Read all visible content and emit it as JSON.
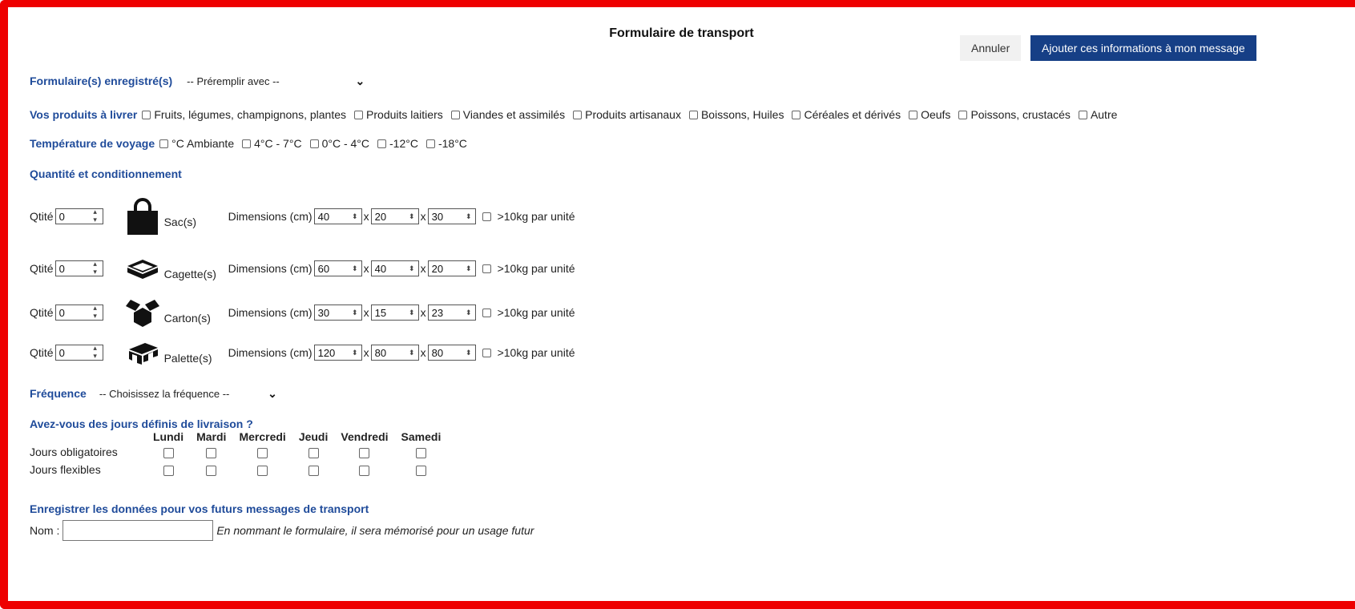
{
  "dialog": {
    "title": "Formulaire de transport",
    "cancel_label": "Annuler",
    "add_label": "Ajouter ces informations à mon message"
  },
  "saved_forms": {
    "label": "Formulaire(s) enregistré(s)",
    "select_value": "-- Préremplir avec --"
  },
  "products": {
    "label": "Vos produits à livrer",
    "options": [
      "Fruits, légumes, champignons, plantes",
      "Produits laitiers",
      "Viandes et assimilés",
      "Produits artisanaux",
      "Boissons, Huiles",
      "Céréales et dérivés",
      "Oeufs",
      "Poissons, crustacés",
      "Autre"
    ]
  },
  "temperature": {
    "label": "Température de voyage",
    "options": [
      "°C Ambiante",
      "4°C - 7°C",
      "0°C - 4°C",
      "-12°C",
      "-18°C"
    ]
  },
  "quantity": {
    "section_label": "Quantité et conditionnement",
    "qty_label": "Qtité",
    "dims_label": "Dimensions (cm)",
    "times": "x",
    "heavy_label": ">10kg par unité",
    "rows": [
      {
        "icon": "bag-icon",
        "type": "Sac(s)",
        "qty": "0",
        "d1": "40",
        "d2": "20",
        "d3": "30"
      },
      {
        "icon": "crate-icon",
        "type": "Cagette(s)",
        "qty": "0",
        "d1": "60",
        "d2": "40",
        "d3": "20"
      },
      {
        "icon": "box-icon",
        "type": "Carton(s)",
        "qty": "0",
        "d1": "30",
        "d2": "15",
        "d3": "23"
      },
      {
        "icon": "pallet-icon",
        "type": "Palette(s)",
        "qty": "0",
        "d1": "120",
        "d2": "80",
        "d3": "80"
      }
    ]
  },
  "frequency": {
    "label": "Fréquence",
    "select_value": "-- Choisissez la fréquence --"
  },
  "days": {
    "label": "Avez-vous des jours définis de livraison ?",
    "columns": [
      "Lundi",
      "Mardi",
      "Mercredi",
      "Jeudi",
      "Vendredi",
      "Samedi"
    ],
    "rows": [
      "Jours obligatoires",
      "Jours flexibles"
    ]
  },
  "save": {
    "label": "Enregistrer les données pour vos futurs messages de transport",
    "name_label": "Nom :",
    "name_value": "",
    "hint": "En nommant le formulaire, il sera mémorisé pour un usage futur"
  }
}
